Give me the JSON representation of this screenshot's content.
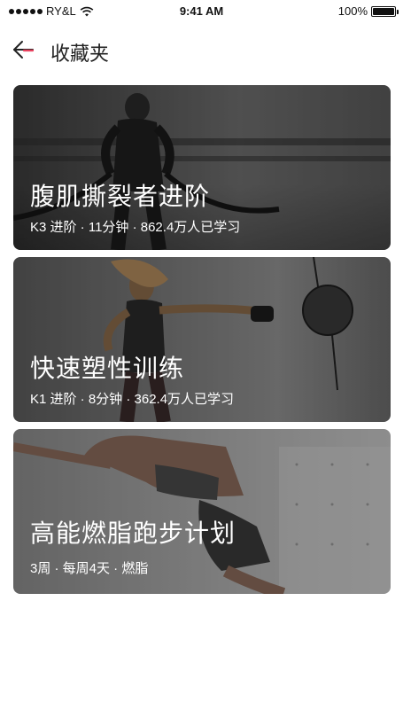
{
  "status_bar": {
    "carrier": "RY&L",
    "time": "9:41 AM",
    "battery": "100%"
  },
  "header": {
    "title": "收藏夹"
  },
  "cards": [
    {
      "title": "腹肌撕裂者进阶",
      "meta": "K3 进阶 · 11分钟 · 862.4万人已学习"
    },
    {
      "title": "快速塑性训练",
      "meta": "K1 进阶 · 8分钟 · 362.4万人已学习"
    },
    {
      "title": "高能燃脂跑步计划",
      "meta": "3周 · 每周4天 · 燃脂"
    }
  ],
  "colors": {
    "back_accent": "#e8415e",
    "text_primary": "#222222",
    "card_text": "#ffffff"
  }
}
